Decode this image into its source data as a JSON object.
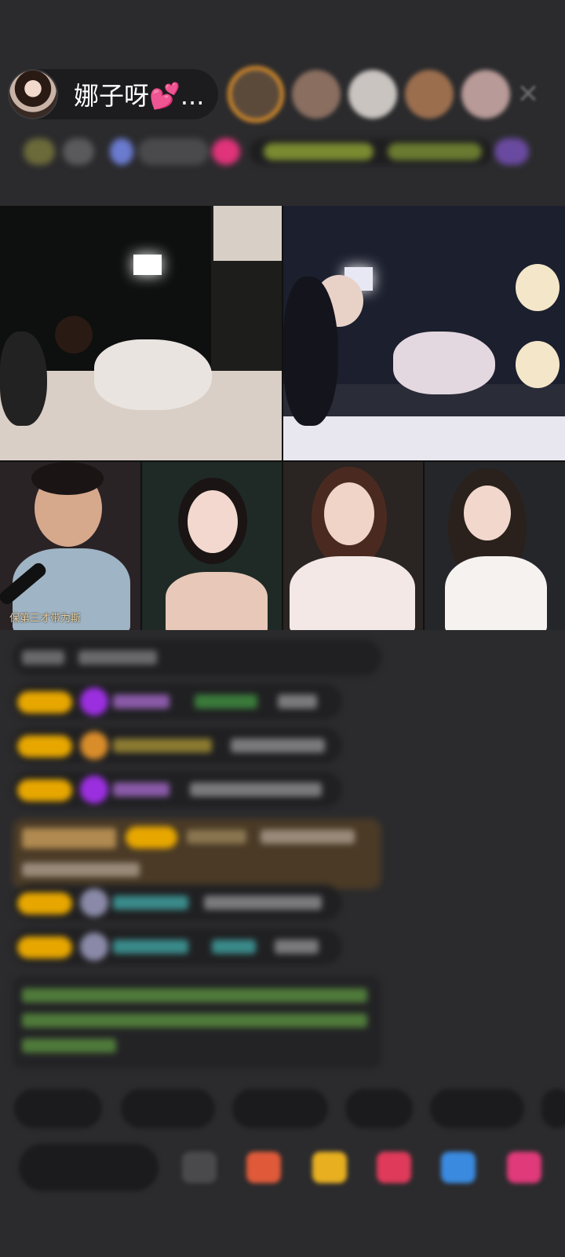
{
  "header": {
    "host_name": "娜子呀💕...",
    "viewer_avatar_colors": [
      "#5b4a3a",
      "#8a6e60",
      "#c9c4c0",
      "#9b6e4e",
      "#b89a98"
    ],
    "accent_ring_color": "#d98d2a"
  },
  "video_grid": {
    "caption_text": "保第三才带为斯"
  },
  "colors": {
    "background": "#2b2b2d",
    "badge_gold": "#e7a700",
    "badge_purple": "#9b2fe0",
    "badge_orange": "#d98d2a",
    "chat_green": "#7fc25a",
    "chat_cyan": "#4fc3c3"
  },
  "icons": [
    "close-icon",
    "diamond-icon",
    "gift-icon",
    "share-icon",
    "more-icon"
  ]
}
